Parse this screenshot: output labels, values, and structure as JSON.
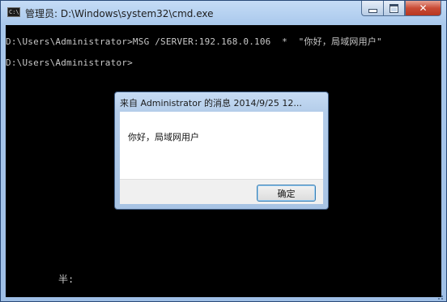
{
  "window": {
    "title": "管理员: D:\\Windows\\system32\\cmd.exe",
    "app_icon_text": "C:\\",
    "controls": {
      "minimize": "minimize-icon",
      "maximize": "maximize-icon",
      "close": "close-icon"
    },
    "close_glyph": "✕"
  },
  "console": {
    "lines": [
      "D:\\Users\\Administrator>MSG /SERVER:192.168.0.106  *  \"你好，局域网用户\"",
      "",
      "D:\\Users\\Administrator>"
    ],
    "stray_text": "半:"
  },
  "message_box": {
    "title": "来自 Administrator 的消息 2014/9/25 12...",
    "body": "你好，局域网用户",
    "ok_label": "确定"
  },
  "colors": {
    "console_bg": "#000000",
    "console_text": "#c8c8c8",
    "close_button": "#c94b36",
    "frame": "#a9c8ec"
  }
}
